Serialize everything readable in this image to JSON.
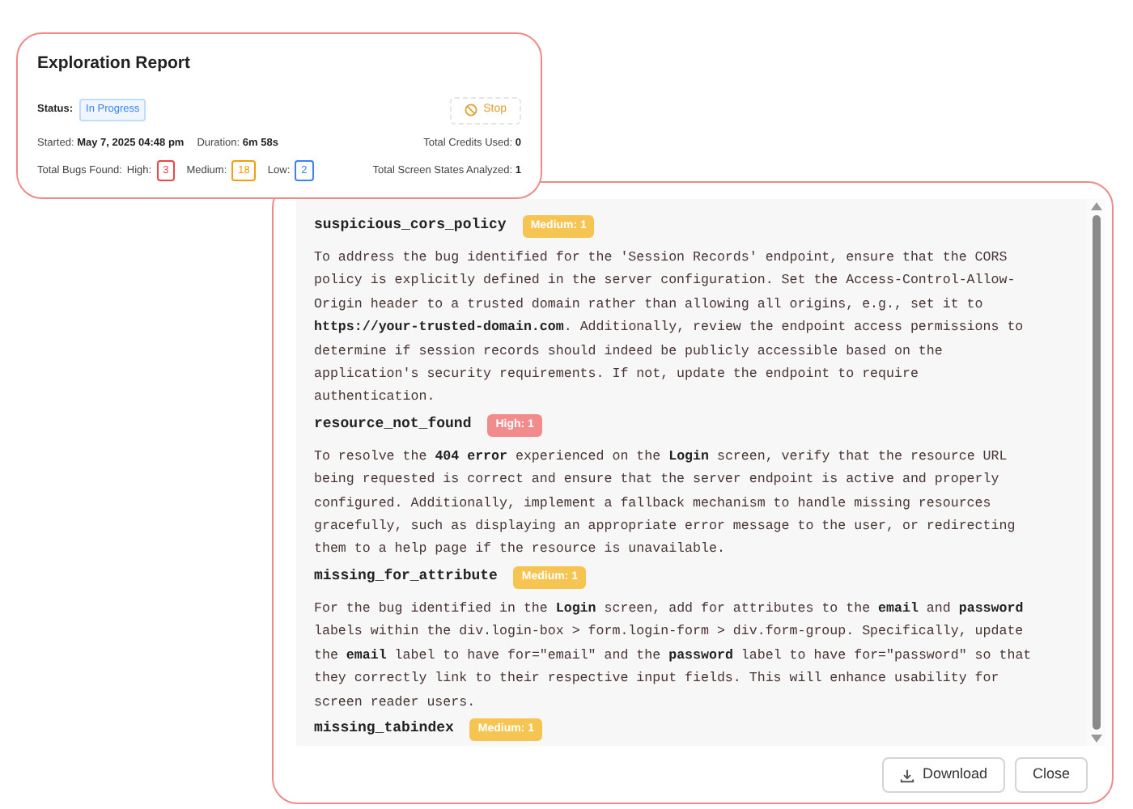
{
  "report": {
    "title": "Exploration Report",
    "status_label": "Status:",
    "status": "In Progress",
    "stop_button": "Stop",
    "started_label": "Started:",
    "started": "May 7, 2025 04:48 pm",
    "duration_label": "Duration:",
    "duration": "6m 58s",
    "credits_label": "Total Credits Used:",
    "credits": "0",
    "bugs_label": "Total Bugs Found:",
    "bug_counts": [
      {
        "label": "High:",
        "count": "3",
        "color": "#ef4444"
      },
      {
        "label": "Medium:",
        "count": "18",
        "color": "#f59e0b"
      },
      {
        "label": "Low:",
        "count": "2",
        "color": "#3b82f6"
      }
    ],
    "screens_label": "Total Screen States Analyzed:",
    "screens": "1"
  },
  "findings": [
    {
      "name": "suspicious_cors_policy",
      "color": "#f5c451",
      "badge": "Medium: 1",
      "text": "To address the bug identified for the 'Session Records' endpoint, ensure that the CORS policy is explicitly defined in the server configuration. Set the Access-Control-Allow-Origin header to a trusted domain rather than allowing all origins, e.g., set it to **https://your-trusted-domain.com**. Additionally, review the endpoint access permissions to determine if session records should indeed be publicly accessible based on the application's security requirements. If not, update the endpoint to require authentication."
    },
    {
      "name": "resource_not_found",
      "color": "#f28b8b",
      "badge": "High: 1",
      "text": "To resolve the **404 error** experienced on the **Login** screen, verify that the resource URL being requested is correct and ensure that the server endpoint is active and properly configured. Additionally, implement a fallback mechanism to handle missing resources gracefully, such as displaying an appropriate error message to the user, or redirecting them to a help page if the resource is unavailable."
    },
    {
      "name": "missing_for_attribute",
      "color": "#f5c451",
      "badge": "Medium: 1",
      "text": "For the bug identified in the **Login** screen, add for attributes to the **email** and **password** labels within the div.login-box > form.login-form > div.form-group. Specifically, update the **email** label to have for=\"email\" and the **password** label to have for=\"password\" so that they correctly link to their respective input fields. This will enhance usability for screen reader users."
    },
    {
      "name": "missing_tabindex",
      "color": "#f5c451",
      "badge": "Medium: 1"
    }
  ],
  "buttons": [
    {
      "label": "Download",
      "kind": "download"
    },
    {
      "label": "Close",
      "kind": "close"
    }
  ]
}
